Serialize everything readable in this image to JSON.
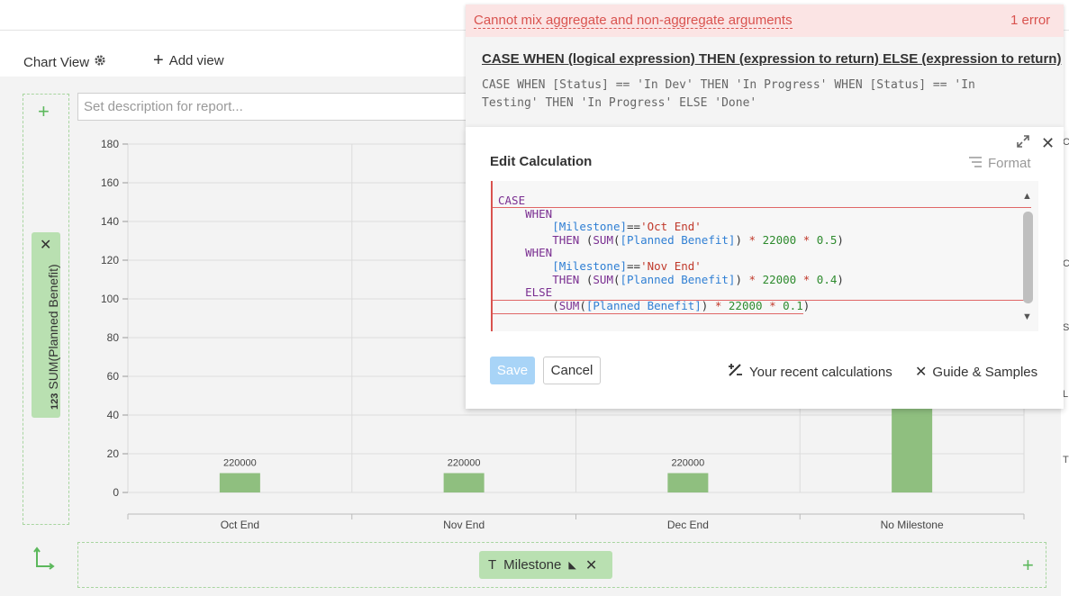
{
  "toolbar": {
    "chart_view_label": "Chart View",
    "add_view_label": "Add view"
  },
  "report": {
    "description_placeholder": "Set description for report..."
  },
  "shelves": {
    "y_pill_type": "123",
    "y_pill_label": "SUM(Planned Benefit)",
    "x_pill_type": "T",
    "x_pill_label": "Milestone"
  },
  "chart_data": {
    "type": "bar",
    "categories": [
      "Oct End",
      "Nov End",
      "Dec End",
      "No Milestone"
    ],
    "values": [
      220000,
      220000,
      220000,
      null
    ],
    "data_labels": [
      "220000",
      "220000",
      "220000",
      ""
    ],
    "yticks": [
      "0",
      "20",
      "40",
      "60",
      "80",
      "100",
      "120",
      "140",
      "160",
      "180"
    ],
    "ylim": [
      0,
      180
    ],
    "bar_color": "#8fbf7f",
    "grid": true,
    "notes_visible_bar_heights": [
      10,
      10,
      10,
      180
    ]
  },
  "error": {
    "message": "Cannot mix aggregate and non-aggregate arguments",
    "count": "1 error",
    "syntax_title": "CASE WHEN (logical expression) THEN (expression to return) ELSE (expression to return)",
    "syntax_example": "CASE WHEN [Status] == 'In Dev' THEN 'In Progress' WHEN [Status] == 'In Testing' THEN 'In Progress' ELSE 'Done'"
  },
  "calc": {
    "title": "Edit Calculation",
    "format_label": "Format",
    "save_label": "Save",
    "cancel_label": "Cancel",
    "recent_label": "Your recent calculations",
    "guide_label": "Guide & Samples",
    "code": {
      "case": "CASE",
      "when": "WHEN",
      "then": "THEN",
      "else": "ELSE",
      "field_milestone": "[Milestone]",
      "field_benefit": "[Planned Benefit]",
      "eq": "==",
      "str_oct": "'Oct End'",
      "str_nov": "'Nov End'",
      "sum": "SUM",
      "n22000": "22000",
      "n05": "0.5",
      "n04": "0.4",
      "n01": "0.1"
    }
  },
  "colors": {
    "accent_green": "#5cb85c",
    "pill_green": "#b9e0b1",
    "error_red": "#d9534f",
    "save_blue": "#a8d4f7"
  }
}
